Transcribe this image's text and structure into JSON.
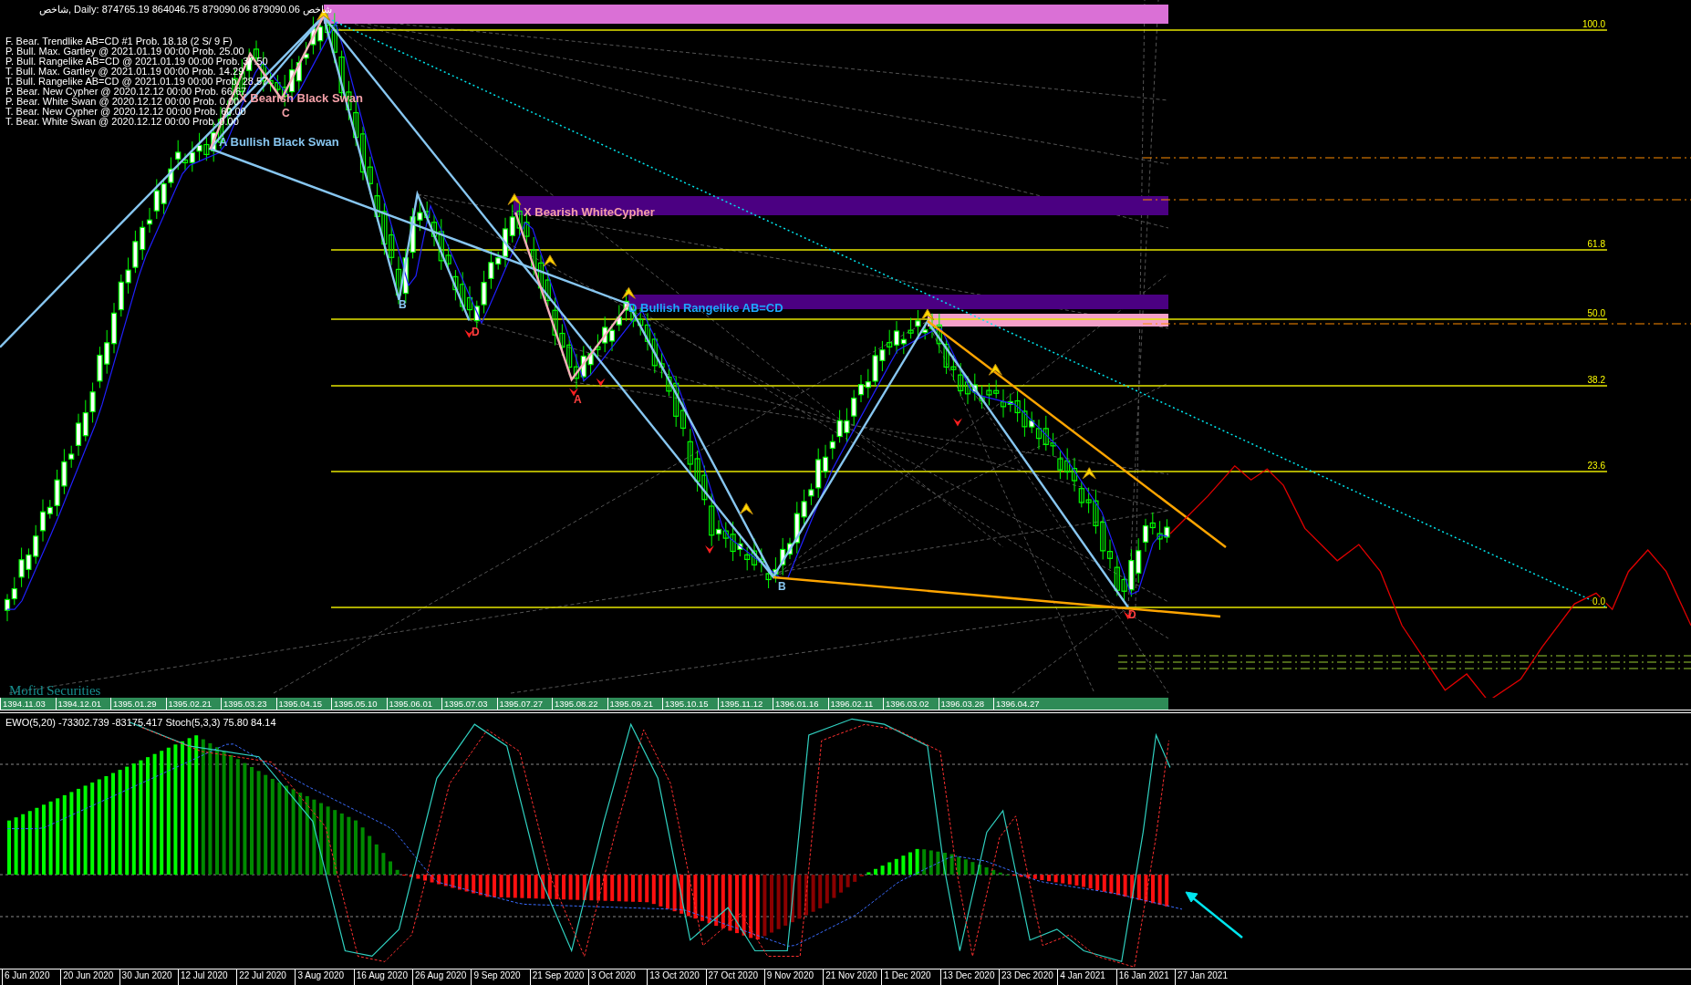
{
  "chart": {
    "header": "شاخص, Daily:  874765.19 864046.75 879090.06 879090.06  شاخص",
    "legend": [
      "F. Bear. Trendlike AB=CD #1 Prob. 18.18 (2 S/ 9 F)",
      "P. Bull. Max. Gartley @ 2021.01.19 00:00 Prob. 25.00",
      "P. Bull. Rangelike AB=CD @ 2021.01.19 00:00 Prob. 37.50",
      "T. Bull. Max. Gartley @ 2021.01.19 00:00 Prob. 14.29",
      "T. Bull. Rangelike AB=CD @ 2021.01.19 00:00 Prob. 28.57",
      "P. Bear. New Cypher @ 2020.12.12 00:00 Prob. 66.67",
      "P. Bear. White Swan @ 2020.12.12 00:00 Prob. 0.00",
      "T. Bear. New Cypher @ 2020.12.12 00:00 Prob. 60.00",
      "T. Bear. White Swan @ 2020.12.12 00:00 Prob. 0.00"
    ],
    "pattern_labels": [
      {
        "text": "X Bearish Black Swan",
        "color": "#f4a0a8"
      },
      {
        "text": "A Bullish Black Swan",
        "color": "#87c6f0"
      },
      {
        "text": "X Bearish WhiteCypher",
        "color": "#f4a0a8"
      },
      {
        "text": "D Bullish Rangelike AB=CD",
        "color": "#1ea8ff"
      }
    ],
    "point_labels": [
      {
        "text": "C",
        "color": "#f4a0a8"
      },
      {
        "text": "B",
        "color": "#87c6f0"
      },
      {
        "text": "D",
        "color": "#ff4040"
      },
      {
        "text": "A",
        "color": "#ff4040"
      },
      {
        "text": "B",
        "color": "#87c6f0"
      },
      {
        "text": "D",
        "color": "#ff4040"
      }
    ],
    "fib_levels": [
      "100.0",
      "61.8",
      "50.0",
      "38.2",
      "23.6",
      "0.0"
    ],
    "broker_label": "Mofid Securities",
    "persian_dates": [
      "1394.11.03",
      "1394.12.01",
      "1395.01.29",
      "1395.02.21",
      "1395.03.23",
      "1395.04.15",
      "1395.05.10",
      "1395.06.01",
      "1395.07.03",
      "1395.07.27",
      "1395.08.22",
      "1395.09.21",
      "1395.10.15",
      "1395.11.12",
      "1396.01.16",
      "1396.02.11",
      "1396.03.02",
      "1396.03.28",
      "1396.04.27"
    ]
  },
  "indicator": {
    "label": "EWO(5,20) -73302.739 -83175.417 Stoch(5,3,3) 75.80 84.14",
    "dates": [
      "6 Jun 2020",
      "20 Jun 2020",
      "30 Jun 2020",
      "12 Jul 2020",
      "22 Jul 2020",
      "3 Aug 2020",
      "16 Aug 2020",
      "26 Aug 2020",
      "9 Sep 2020",
      "21 Sep 2020",
      "3 Oct 2020",
      "13 Oct 2020",
      "27 Oct 2020",
      "9 Nov 2020",
      "21 Nov 2020",
      "1 Dec 2020",
      "13 Dec 2020",
      "23 Dec 2020",
      "4 Jan 2021",
      "16 Jan 2021",
      "27 Jan 2021"
    ]
  }
}
